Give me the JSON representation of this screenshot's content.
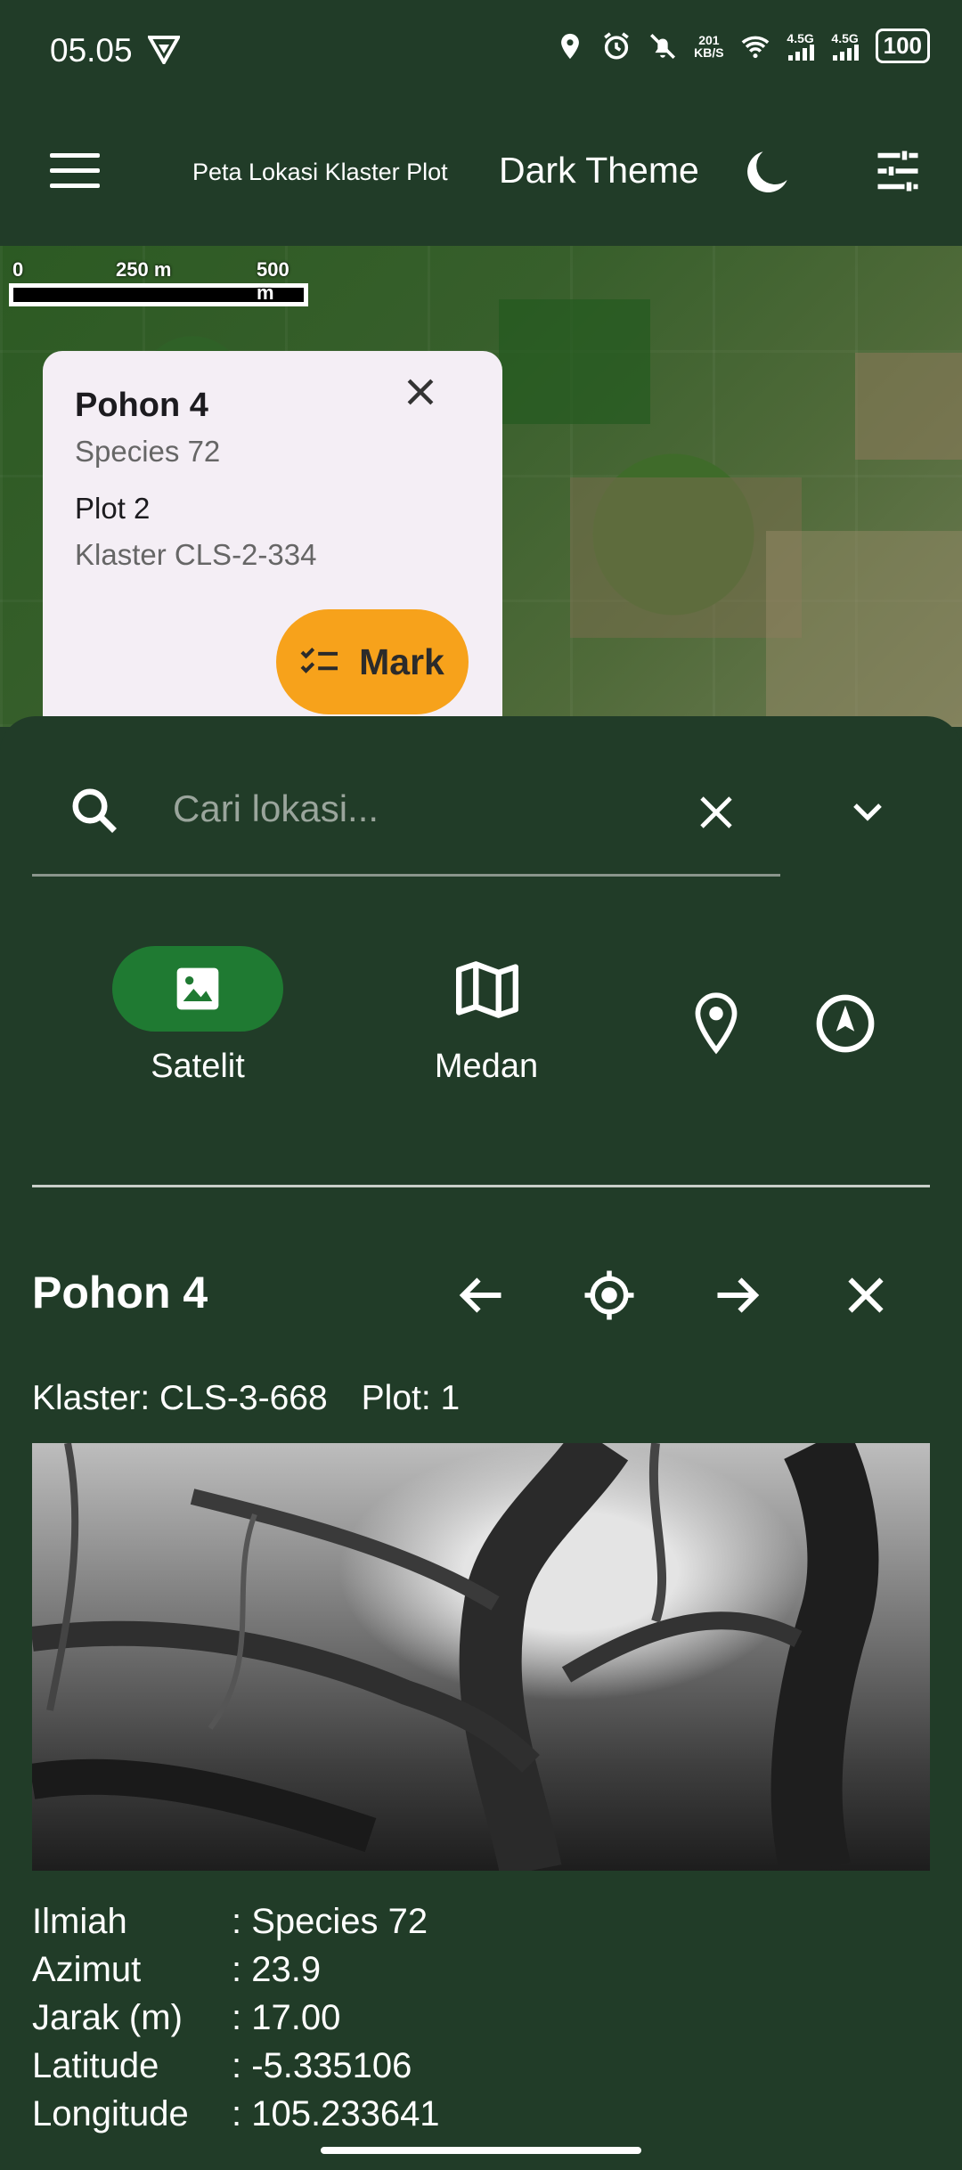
{
  "status_bar": {
    "time": "05.05",
    "net_speed_top": "201",
    "net_speed_bottom": "KB/S",
    "signal1": "4.5G",
    "signal2": "4.5G",
    "battery": "100"
  },
  "app_bar": {
    "title": "Peta Lokasi Klaster Plot",
    "theme_label": "Dark Theme",
    "icons": [
      "menu-icon",
      "moon-icon",
      "tune-icon"
    ]
  },
  "map": {
    "scale_labels": [
      "0",
      "250 m",
      "500 m"
    ]
  },
  "popup": {
    "title": "Pohon 4",
    "species": "Species 72",
    "plot": "Plot 2",
    "cluster": "Klaster CLS-2-334",
    "mark_label": "Mark",
    "colors": {
      "card": "#f4eef5",
      "mark_button": "#f7a21b"
    }
  },
  "search": {
    "placeholder": "Cari lokasi..."
  },
  "map_types": {
    "satellite_label": "Satelit",
    "terrain_label": "Medan",
    "active": "Satelit",
    "active_color": "#1f7a32"
  },
  "detail": {
    "title": "Pohon 4",
    "cluster_text": "Klaster: CLS-3-668",
    "plot_text": "Plot: 1",
    "properties": [
      {
        "key": "Ilmiah",
        "value": ": Species 72"
      },
      {
        "key": "Azimut",
        "value": ": 23.9"
      },
      {
        "key": "Jarak (m)",
        "value": ": 17.00"
      },
      {
        "key": "Latitude",
        "value": ": -5.335106"
      },
      {
        "key": "Longitude",
        "value": ": 105.233641"
      }
    ]
  },
  "theme": {
    "background": "#213c28"
  }
}
